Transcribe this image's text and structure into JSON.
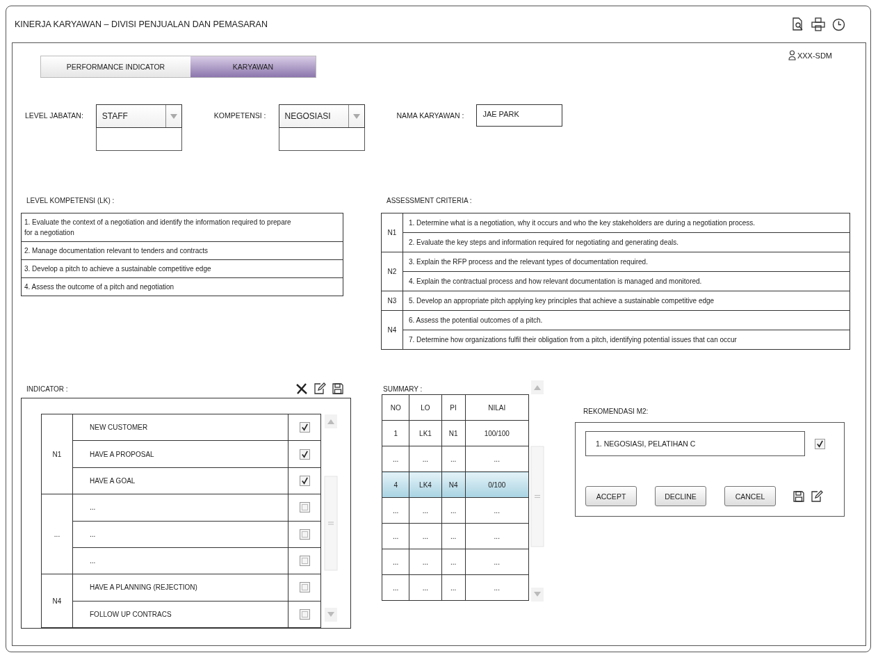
{
  "window": {
    "title": "KINERJA KARYAWAN – DIVISI PENJUALAN DAN PEMASARAN"
  },
  "user": {
    "label": "XXX-SDM"
  },
  "tabs": [
    {
      "label": "PERFORMANCE INDICATOR",
      "selected": false
    },
    {
      "label": "KARYAWAN",
      "selected": true
    }
  ],
  "filters": [
    {
      "kind": "select",
      "label": "LEVEL JABATAN:",
      "value": "STAFF"
    },
    {
      "kind": "select",
      "label": "KOMPETENSI :",
      "value": "NEGOSIASI"
    },
    {
      "kind": "text",
      "label": "NAMA KARYAWAN :",
      "value": "JAE PARK"
    }
  ],
  "level_kompetensi": {
    "title": "LEVEL KOMPETENSI (LK) :",
    "items": [
      "1.  Evaluate the context of a negotiation and identify the information required to prepare for a negotiation",
      "2.  Manage documentation relevant to tenders and contracts",
      "3.  Develop a pitch to achieve a sustainable competitive edge",
      "4. Assess the outcome of a pitch and negotiation"
    ]
  },
  "assessment_criteria": {
    "title": "ASSESSMENT CRITERIA :",
    "groups": [
      {
        "code": "N1",
        "items": [
          "1. Determine what is a negotiation, why it occurs and who the key stakeholders are during a negotiation process.",
          "2. Evaluate the key steps and information required for negotiating and generating deals."
        ]
      },
      {
        "code": "N2",
        "items": [
          "3. Explain the RFP process and the relevant types of documentation required.",
          "4. Explain the contractual process and how relevant documentation is managed and monitored."
        ]
      },
      {
        "code": "N3",
        "items": [
          "5. Develop an appropriate pitch applying key principles that achieve a sustainable competitive edge"
        ]
      },
      {
        "code": "N4",
        "items": [
          "6. Assess the potential outcomes of a pitch.",
          "7. Determine how organizations fulfil their obligation from a pitch, identifying potential issues that can occur"
        ]
      }
    ]
  },
  "indicator": {
    "title": "INDICATOR :",
    "groups": [
      {
        "code": "N1",
        "items": [
          {
            "label": "NEW CUSTOMER",
            "checked": true
          },
          {
            "label": "HAVE A PROPOSAL",
            "checked": true
          },
          {
            "label": "HAVE A GOAL",
            "checked": true
          }
        ]
      },
      {
        "code": "...",
        "items": [
          {
            "label": "...",
            "checked": false
          },
          {
            "label": "...",
            "checked": false
          },
          {
            "label": "...",
            "checked": false
          }
        ]
      },
      {
        "code": "N4",
        "items": [
          {
            "label": "HAVE A PLANNING (REJECTION)",
            "checked": false
          },
          {
            "label": "FOLLOW UP CONTRACS",
            "checked": false
          }
        ]
      }
    ]
  },
  "summary": {
    "title": "SUMMARY :",
    "columns": [
      "NO",
      "LO",
      "PI",
      "NILAI"
    ],
    "rows": [
      {
        "cells": [
          "1",
          "LK1",
          "N1",
          "100/100"
        ],
        "selected": false
      },
      {
        "cells": [
          "...",
          "...",
          "...",
          "..."
        ],
        "selected": false
      },
      {
        "cells": [
          "4",
          "LK4",
          "N4",
          "0/100"
        ],
        "selected": true
      },
      {
        "cells": [
          "...",
          "...",
          "...",
          "..."
        ],
        "selected": false
      },
      {
        "cells": [
          "...",
          "...",
          "...",
          "..."
        ],
        "selected": false
      },
      {
        "cells": [
          "...",
          "...",
          "...",
          "..."
        ],
        "selected": false
      },
      {
        "cells": [
          "...",
          "...",
          "...",
          "..."
        ],
        "selected": false
      }
    ]
  },
  "rekomendasi": {
    "title": "REKOMENDASI M2:",
    "items": [
      {
        "text": "1. NEGOSIASI,  PELATIHAN C",
        "checked": true
      }
    ],
    "buttons": [
      "ACCEPT",
      "DECLINE",
      "CANCEL"
    ]
  }
}
